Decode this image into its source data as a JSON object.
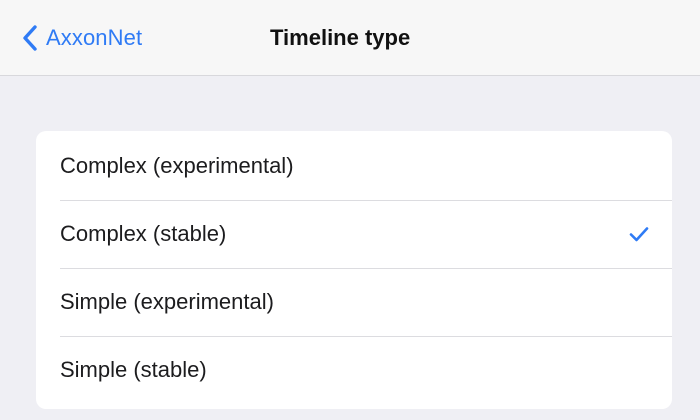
{
  "nav": {
    "back_label": "AxxonNet",
    "title": "Timeline type"
  },
  "options": [
    {
      "label": "Complex (experimental)",
      "selected": false
    },
    {
      "label": "Complex (stable)",
      "selected": true
    },
    {
      "label": "Simple (experimental)",
      "selected": false
    },
    {
      "label": "Simple (stable)",
      "selected": false
    }
  ],
  "colors": {
    "accent": "#2f7bf5",
    "background": "#efeff4",
    "card": "#ffffff"
  },
  "icons": {
    "back": "chevron-left-icon",
    "selected": "checkmark-icon"
  }
}
